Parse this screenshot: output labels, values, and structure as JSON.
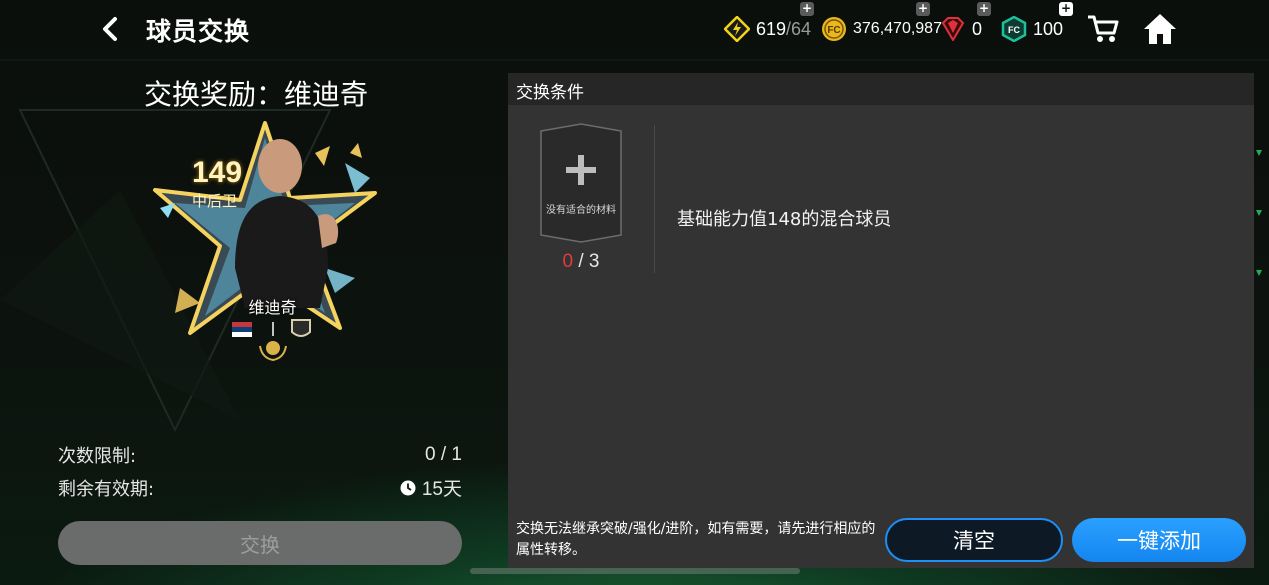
{
  "header": {
    "title": "球员交换",
    "currencies": {
      "energy": {
        "value": "619",
        "max": "/64"
      },
      "coins": {
        "value": "376,470,987"
      },
      "gems": {
        "value": "0"
      },
      "fc_points": {
        "value": "100"
      }
    },
    "plus_badge": "+"
  },
  "left": {
    "reward_title": "交换奖励：维迪奇",
    "card": {
      "rating": "149",
      "position": "中后卫",
      "name": "维迪奇"
    },
    "limit_label": "次数限制:",
    "limit_value": "0 / 1",
    "validity_label": "剩余有效期:",
    "validity_value": "15天",
    "exchange_button": "交换"
  },
  "conditions": {
    "title": "交换条件",
    "slot": {
      "plus": "+",
      "text": "没有适合的材料",
      "count_current": "0",
      "count_total": " / 3"
    },
    "description": "基础能力值148的混合球员",
    "note": "交换无法继承突破/强化/进阶，如有需要，请先进行相应的属性转移。",
    "clear_button": "清空",
    "add_button": "一键添加"
  },
  "colors": {
    "accent_blue": "#1d8ff5",
    "energy_yellow": "#f2d21b",
    "coin_gold": "#e8b81e",
    "gem_red": "#e0303a",
    "fc_teal": "#1fbf9a",
    "count_red": "#e23b3b"
  },
  "icons": [
    "back-chevron-icon",
    "energy-icon",
    "coin-icon",
    "gem-icon",
    "fc-points-icon",
    "cart-icon",
    "home-icon",
    "clock-icon",
    "plus-icon",
    "serbia-flag-icon",
    "club-badge-icon",
    "laurel-icon"
  ]
}
